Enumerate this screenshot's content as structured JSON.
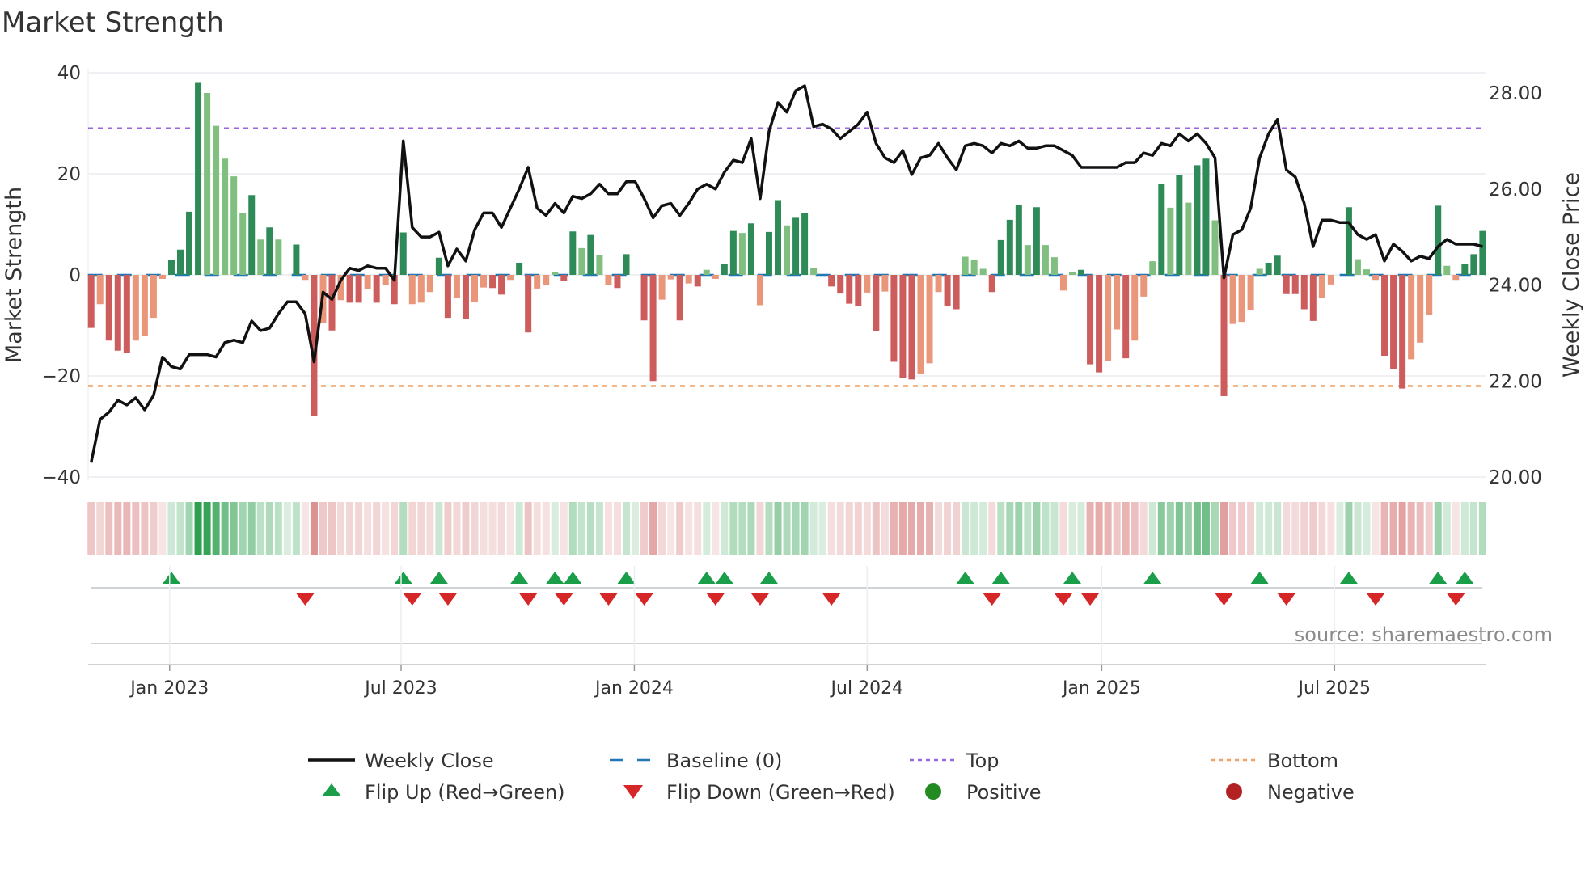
{
  "chart_data": {
    "type": "bar",
    "title": "Market Strength",
    "ylabel": "Market Strength",
    "y2label": "Weekly Close Price",
    "ylim": [
      -40,
      40
    ],
    "y2lim": [
      20,
      28
    ],
    "yticks": [
      "40",
      "20",
      "0",
      "−20",
      "−40"
    ],
    "ytick_values": [
      40,
      20,
      0,
      -20,
      -40
    ],
    "y2ticks": [
      "28.00",
      "26.00",
      "24.00",
      "22.00",
      "20.00"
    ],
    "y2tick_values": [
      28,
      26,
      24,
      22,
      20
    ],
    "top_level": 29,
    "bottom_level": -22,
    "xticks": [
      {
        "label": "Jan 2023",
        "week": 8.8
      },
      {
        "label": "Jul 2023",
        "week": 34.75
      },
      {
        "label": "Jan 2024",
        "week": 60.9
      },
      {
        "label": "Jul 2024",
        "week": 87.0
      },
      {
        "label": "Jan 2025",
        "week": 113.3
      },
      {
        "label": "Jul 2025",
        "week": 139.4
      }
    ],
    "strength": [
      -10.5,
      -5.8,
      -13,
      -15,
      -15.5,
      -13,
      -12,
      -8.5,
      -0.8,
      2.9,
      5,
      12.5,
      38,
      36,
      29.5,
      23,
      19.5,
      12.3,
      15.8,
      7,
      9.4,
      7,
      0,
      6,
      -1,
      -28,
      -9.5,
      -11,
      -5,
      -5.5,
      -5.5,
      -2.8,
      -5.5,
      -2,
      -5.8,
      8.4,
      -5.8,
      -5.5,
      -3.4,
      3.4,
      -8.5,
      -4.5,
      -8.8,
      -5.3,
      -2.5,
      -2.6,
      -3.9,
      -1,
      2.4,
      -11.4,
      -2.7,
      -2,
      0.6,
      -1.2,
      8.6,
      5.3,
      7.9,
      4,
      -2,
      -2.6,
      4.1,
      0,
      -9,
      -21,
      -4.9,
      -0.9,
      -9,
      -1.7,
      -2.3,
      1,
      -0.8,
      2.1,
      8.7,
      8.3,
      10.2,
      -6,
      8.5,
      14.8,
      9.8,
      11.3,
      12.3,
      1.3,
      0,
      -2.3,
      -3.7,
      -5.7,
      -6.2,
      -3.5,
      -11.2,
      -3.3,
      -17.2,
      -20.4,
      -20.7,
      -19.6,
      -17.5,
      -3.4,
      -6.2,
      -6.8,
      3.6,
      3,
      1.2,
      -3.4,
      6.9,
      10.9,
      13.8,
      5.9,
      13.4,
      5.9,
      3.5,
      -3.1,
      0.5,
      1,
      -17.7,
      -19.3,
      -17,
      -10.8,
      -16.5,
      -13,
      -4.3,
      2.7,
      18,
      13.3,
      19.7,
      14.3,
      21.7,
      23,
      10.8,
      -24,
      -9.7,
      -9.3,
      -6.9,
      1.2,
      2.4,
      3.8,
      -3.8,
      -3.8,
      -6.8,
      -9.1,
      -4.6,
      -1.9,
      0,
      13.4,
      3.1,
      1.1,
      -1,
      -16,
      -18.7,
      -22.5,
      -16.7,
      -13.4,
      -8,
      13.7,
      1.8,
      -1,
      2.1,
      4.1,
      8.7
    ],
    "weekly_close": [
      20.3,
      21.2,
      21.35,
      21.6,
      21.5,
      21.65,
      21.4,
      21.7,
      22.5,
      22.3,
      22.25,
      22.55,
      22.55,
      22.55,
      22.5,
      22.8,
      22.85,
      22.8,
      23.25,
      23.05,
      23.1,
      23.4,
      23.65,
      23.65,
      23.4,
      22.4,
      23.85,
      23.7,
      24.1,
      24.35,
      24.3,
      24.4,
      24.35,
      24.35,
      24.1,
      27.0,
      25.2,
      25.0,
      25.0,
      25.1,
      24.4,
      24.75,
      24.5,
      25.15,
      25.5,
      25.5,
      25.2,
      25.6,
      26.0,
      26.45,
      25.6,
      25.45,
      25.7,
      25.5,
      25.85,
      25.8,
      25.9,
      26.1,
      25.9,
      25.9,
      26.15,
      26.15,
      25.8,
      25.4,
      25.65,
      25.7,
      25.45,
      25.7,
      26.0,
      26.1,
      26.0,
      26.35,
      26.6,
      26.55,
      27.05,
      25.8,
      27.2,
      27.8,
      27.6,
      28.05,
      28.15,
      27.3,
      27.35,
      27.25,
      27.05,
      27.2,
      27.35,
      27.6,
      26.95,
      26.65,
      26.55,
      26.8,
      26.3,
      26.65,
      26.7,
      26.95,
      26.65,
      26.4,
      26.9,
      26.95,
      26.9,
      26.75,
      26.95,
      26.9,
      27.0,
      26.85,
      26.85,
      26.9,
      26.9,
      26.8,
      26.7,
      26.45,
      26.45,
      26.45,
      26.45,
      26.45,
      26.55,
      26.55,
      26.75,
      26.7,
      26.95,
      26.9,
      27.15,
      27.0,
      27.15,
      26.95,
      26.65,
      24.15,
      25.05,
      25.15,
      25.6,
      26.65,
      27.15,
      27.45,
      26.4,
      26.25,
      25.7,
      24.8,
      25.35,
      25.35,
      25.3,
      25.3,
      25.05,
      24.95,
      25.05,
      24.5,
      24.85,
      24.7,
      24.5,
      24.6,
      24.55,
      24.8,
      24.95,
      24.85,
      24.85,
      24.85,
      24.8
    ],
    "legend": {
      "placement": "bottom",
      "items": [
        {
          "label": "Weekly Close",
          "symbol": "line"
        },
        {
          "label": "Baseline (0)",
          "symbol": "dash"
        },
        {
          "label": "Top",
          "symbol": "dot-purple"
        },
        {
          "label": "Bottom",
          "symbol": "dot-orange"
        },
        {
          "label": "Flip Up (Red→Green)",
          "symbol": "triangle-up"
        },
        {
          "label": "Flip Down (Green→Red)",
          "symbol": "triangle-down"
        },
        {
          "label": "Positive",
          "symbol": "circle-green"
        },
        {
          "label": "Negative",
          "symbol": "circle-red"
        }
      ]
    },
    "source": "source: sharemaestro.com"
  },
  "colors": {
    "pos_strong": "#2e8b57",
    "pos_weak": "#80bf80",
    "neg_strong": "#cd5c5c",
    "neg_weak": "#e9967a",
    "line": "#111111",
    "baseline": "#1f77b4",
    "top": "#9b66dd",
    "bottom": "#f0a060",
    "flip_up": "#1a9e4a",
    "flip_down": "#d62728",
    "positive": "#228b22",
    "negative": "#b22222"
  }
}
